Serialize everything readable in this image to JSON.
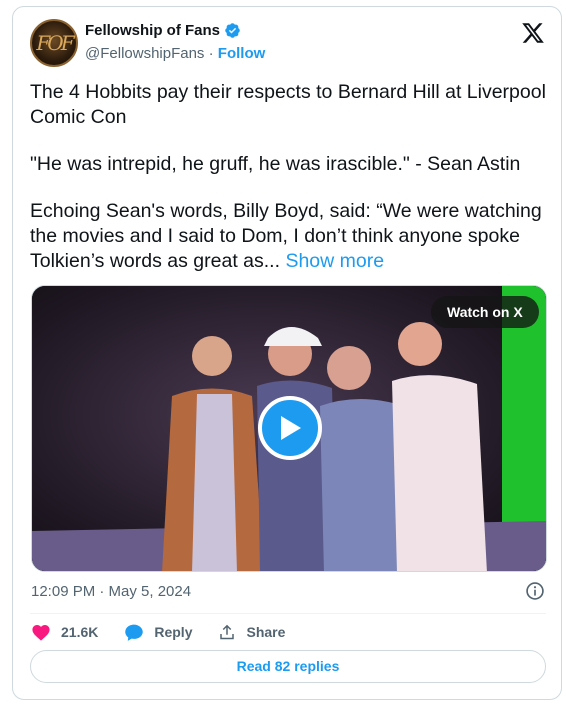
{
  "author": {
    "name": "Fellowship of Fans",
    "handle": "@FellowshipFans",
    "separator": " · ",
    "follow_label": "Follow",
    "avatar_text": "FOF",
    "verified": true
  },
  "tweet": {
    "paragraphs": [
      "The 4 Hobbits pay their respects to Bernard Hill at Liverpool Comic Con",
      "\"He was intrepid, he gruff, he was irascible.\" - Sean Astin"
    ],
    "truncated_text": "Echoing Sean's words, Billy Boyd, said: “We were watching the movies and I said to Dom, I don’t think anyone spoke Tolkien’s words as great as...",
    "show_more_label": "Show more"
  },
  "media": {
    "watch_label": "Watch on X"
  },
  "meta": {
    "timestamp": "12:09 PM · May 5, 2024"
  },
  "actions": {
    "likes": "21.6K",
    "reply_label": "Reply",
    "share_label": "Share"
  },
  "footer": {
    "read_replies_label": "Read 82 replies"
  },
  "colors": {
    "accent": "#1d9bf0",
    "like": "#f91880",
    "muted": "#536471"
  }
}
